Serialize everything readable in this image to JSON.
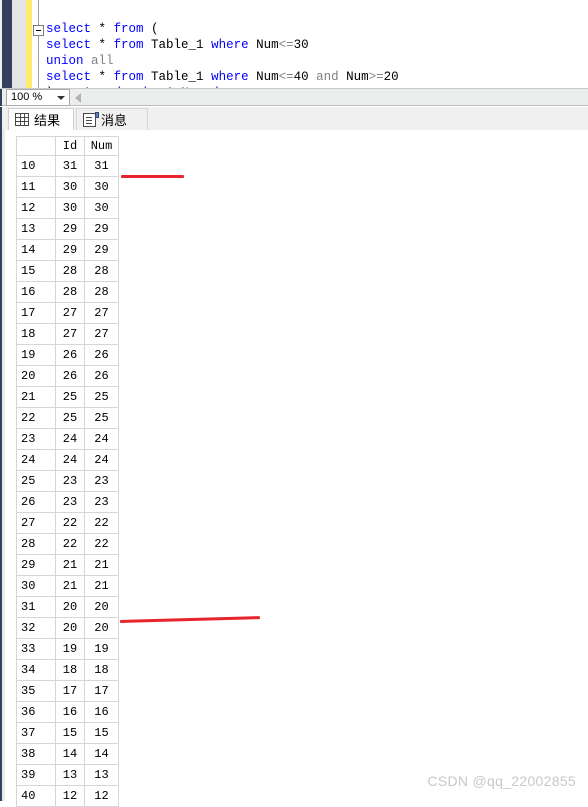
{
  "editor": {
    "zoom_level": "100 %",
    "lines": [
      {
        "indent": 0,
        "tokens": [
          {
            "t": "select",
            "c": "kw"
          },
          {
            "t": " * ",
            "c": "pl"
          },
          {
            "t": "from",
            "c": "kw"
          },
          {
            "t": " (",
            "c": "pl"
          }
        ]
      },
      {
        "indent": 1,
        "tokens": [
          {
            "t": "select",
            "c": "kw"
          },
          {
            "t": " * ",
            "c": "pl"
          },
          {
            "t": "from",
            "c": "kw"
          },
          {
            "t": " Table_1 ",
            "c": "pl"
          },
          {
            "t": "where",
            "c": "kw"
          },
          {
            "t": " Num",
            "c": "pl"
          },
          {
            "t": "<=",
            "c": "op"
          },
          {
            "t": "30",
            "c": "pl"
          }
        ]
      },
      {
        "indent": 0,
        "tokens": [
          {
            "t": "union",
            "c": "kw"
          },
          {
            "t": " ",
            "c": "pl"
          },
          {
            "t": "all",
            "c": "gray"
          }
        ]
      },
      {
        "indent": 0,
        "tokens": [
          {
            "t": "select",
            "c": "kw"
          },
          {
            "t": " * ",
            "c": "pl"
          },
          {
            "t": "from",
            "c": "kw"
          },
          {
            "t": " Table_1 ",
            "c": "pl"
          },
          {
            "t": "where",
            "c": "kw"
          },
          {
            "t": " Num",
            "c": "pl"
          },
          {
            "t": "<=",
            "c": "op"
          },
          {
            "t": "40 ",
            "c": "pl"
          },
          {
            "t": "and",
            "c": "gray"
          },
          {
            "t": " Num",
            "c": "pl"
          },
          {
            "t": ">=",
            "c": "op"
          },
          {
            "t": "20",
            "c": "pl"
          }
        ]
      },
      {
        "indent": 0,
        "tokens": [
          {
            "t": ") ",
            "c": "pl"
          },
          {
            "t": "as",
            "c": "kw"
          },
          {
            "t": " A ",
            "c": "pl"
          },
          {
            "t": "order",
            "c": "kw"
          },
          {
            "t": " ",
            "c": "pl"
          },
          {
            "t": "by",
            "c": "kw"
          },
          {
            "t": " A.Num ",
            "c": "pl"
          },
          {
            "t": "desc",
            "c": "kw"
          }
        ]
      }
    ],
    "full_sql": "select * from (\nselect * from Table_1 where Num<=30\nunion all\nselect * from Table_1 where Num<=40 and Num>=20\n) as A order by A.Num desc"
  },
  "tabs": [
    {
      "label": "结果",
      "icon": "grid-icon",
      "active": true
    },
    {
      "label": "消息",
      "icon": "message-icon",
      "active": false
    }
  ],
  "grid": {
    "columns": [
      "",
      "Id",
      "Num"
    ],
    "rows": [
      {
        "n": "10",
        "id": "31",
        "num": "31"
      },
      {
        "n": "11",
        "id": "30",
        "num": "30"
      },
      {
        "n": "12",
        "id": "30",
        "num": "30"
      },
      {
        "n": "13",
        "id": "29",
        "num": "29"
      },
      {
        "n": "14",
        "id": "29",
        "num": "29"
      },
      {
        "n": "15",
        "id": "28",
        "num": "28"
      },
      {
        "n": "16",
        "id": "28",
        "num": "28"
      },
      {
        "n": "17",
        "id": "27",
        "num": "27"
      },
      {
        "n": "18",
        "id": "27",
        "num": "27"
      },
      {
        "n": "19",
        "id": "26",
        "num": "26"
      },
      {
        "n": "20",
        "id": "26",
        "num": "26"
      },
      {
        "n": "21",
        "id": "25",
        "num": "25"
      },
      {
        "n": "22",
        "id": "25",
        "num": "25"
      },
      {
        "n": "23",
        "id": "24",
        "num": "24"
      },
      {
        "n": "24",
        "id": "24",
        "num": "24"
      },
      {
        "n": "25",
        "id": "23",
        "num": "23"
      },
      {
        "n": "26",
        "id": "23",
        "num": "23"
      },
      {
        "n": "27",
        "id": "22",
        "num": "22"
      },
      {
        "n": "28",
        "id": "22",
        "num": "22"
      },
      {
        "n": "29",
        "id": "21",
        "num": "21"
      },
      {
        "n": "30",
        "id": "21",
        "num": "21"
      },
      {
        "n": "31",
        "id": "20",
        "num": "20"
      },
      {
        "n": "32",
        "id": "20",
        "num": "20"
      },
      {
        "n": "33",
        "id": "19",
        "num": "19"
      },
      {
        "n": "34",
        "id": "18",
        "num": "18"
      },
      {
        "n": "35",
        "id": "17",
        "num": "17"
      },
      {
        "n": "36",
        "id": "16",
        "num": "16"
      },
      {
        "n": "37",
        "id": "15",
        "num": "15"
      },
      {
        "n": "38",
        "id": "14",
        "num": "14"
      },
      {
        "n": "39",
        "id": "13",
        "num": "13"
      },
      {
        "n": "40",
        "id": "12",
        "num": "12"
      }
    ]
  },
  "annotations": [
    {
      "name": "red-underline-top",
      "color": "#e8252a"
    },
    {
      "name": "red-underline-bottom",
      "color": "#e8252a"
    }
  ],
  "watermark": {
    "text": "CSDN @qq_22002855"
  }
}
